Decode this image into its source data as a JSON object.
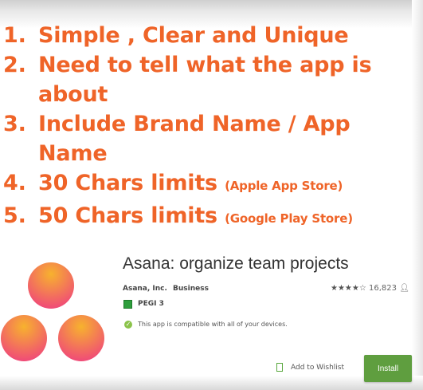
{
  "slide": {
    "points": [
      {
        "num": "1.",
        "text": "Simple , Clear and Unique",
        "note": ""
      },
      {
        "num": "2.",
        "text": "Need to tell what the app is",
        "note": ""
      },
      {
        "num": "",
        "text": "about",
        "note": ""
      },
      {
        "num": "3.",
        "text": "Include Brand Name / App",
        "note": ""
      },
      {
        "num": "",
        "text": "Name",
        "note": ""
      },
      {
        "num": "4.",
        "text": "30 Chars limits ",
        "note": "(Apple  App Store)"
      },
      {
        "num": "5.",
        "text": "50 Chars limits ",
        "note": "(Google Play Store)"
      }
    ]
  },
  "store_card": {
    "title": "Asana: organize team projects",
    "developer": "Asana, Inc.",
    "category": "Business",
    "stars": "★★★★☆",
    "review_count": "16,823",
    "user_icon": "person-icon",
    "pegi": "PEGI 3",
    "compat": "This app is compatible with all of your devices.",
    "wishlist": "Add to Wishlist",
    "install": "Install",
    "colors": {
      "accent": "#ef6428",
      "install_button": "#5f9e3f",
      "logo_gradient_top": "#f5a623",
      "logo_gradient_bottom": "#f04a78"
    }
  }
}
